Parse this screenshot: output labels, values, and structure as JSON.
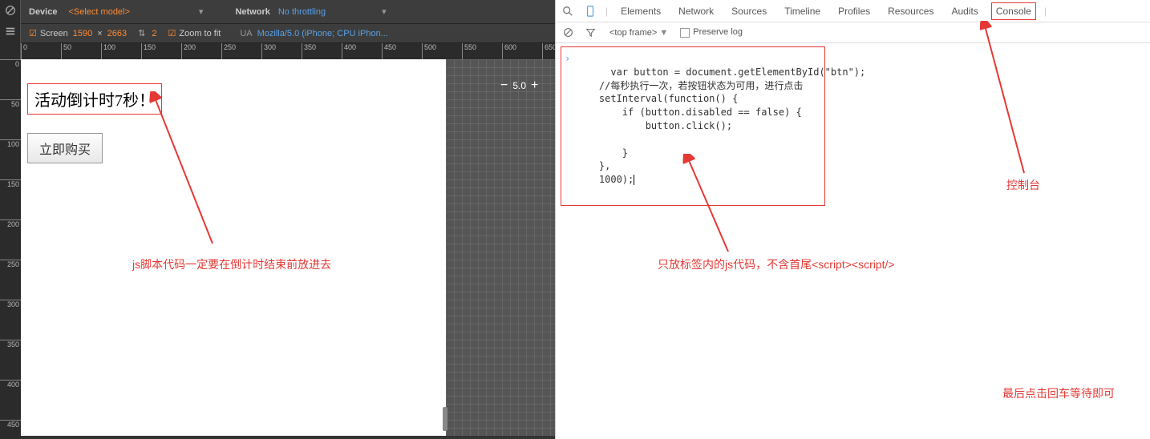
{
  "device_toolbar": {
    "device_label": "Device",
    "device_value": "<Select model>",
    "network_label": "Network",
    "network_value": "No throttling",
    "screen_label": "Screen",
    "screen_w": "1590",
    "screen_h": "2663",
    "zoom2_val": "2",
    "zoom_fit_label": "Zoom to fit",
    "ua_label": "UA",
    "ua_value": "Mozilla/5.0 (iPhone; CPU iPhon..."
  },
  "ruler_top": [
    "0",
    "50",
    "100",
    "150",
    "200",
    "250",
    "300",
    "350",
    "400",
    "450",
    "500",
    "550",
    "600",
    "650"
  ],
  "ruler_left": [
    "0",
    "50",
    "100",
    "150",
    "200",
    "250",
    "300",
    "350",
    "400",
    "450"
  ],
  "canvas_zoom": {
    "minus": "−",
    "value": "5.0",
    "plus": "+"
  },
  "page_content": {
    "countdown_text": "活动倒计时7秒！",
    "buy_button": "立即购买"
  },
  "annotations": {
    "a1": "js脚本代码一定要在倒计时结束前放进去",
    "a2": "只放标签内的js代码，不含首尾<script><script/>",
    "a3": "控制台",
    "a4": "最后点击回车等待即可"
  },
  "devtools": {
    "tabs": [
      "Elements",
      "Network",
      "Sources",
      "Timeline",
      "Profiles",
      "Resources",
      "Audits",
      "Console"
    ],
    "highlight_tab_index": 7,
    "frame_label": "<top frame>",
    "preserve_log": "Preserve log",
    "code_lines": [
      "var button = document.getElementById(\"btn\");",
      "    //每秒执行一次，若按钮状态为可用，进行点击",
      "    setInterval(function() {",
      "        if (button.disabled == false) {",
      "            button.click();",
      "",
      "        }",
      "    },",
      "    1000);"
    ]
  }
}
